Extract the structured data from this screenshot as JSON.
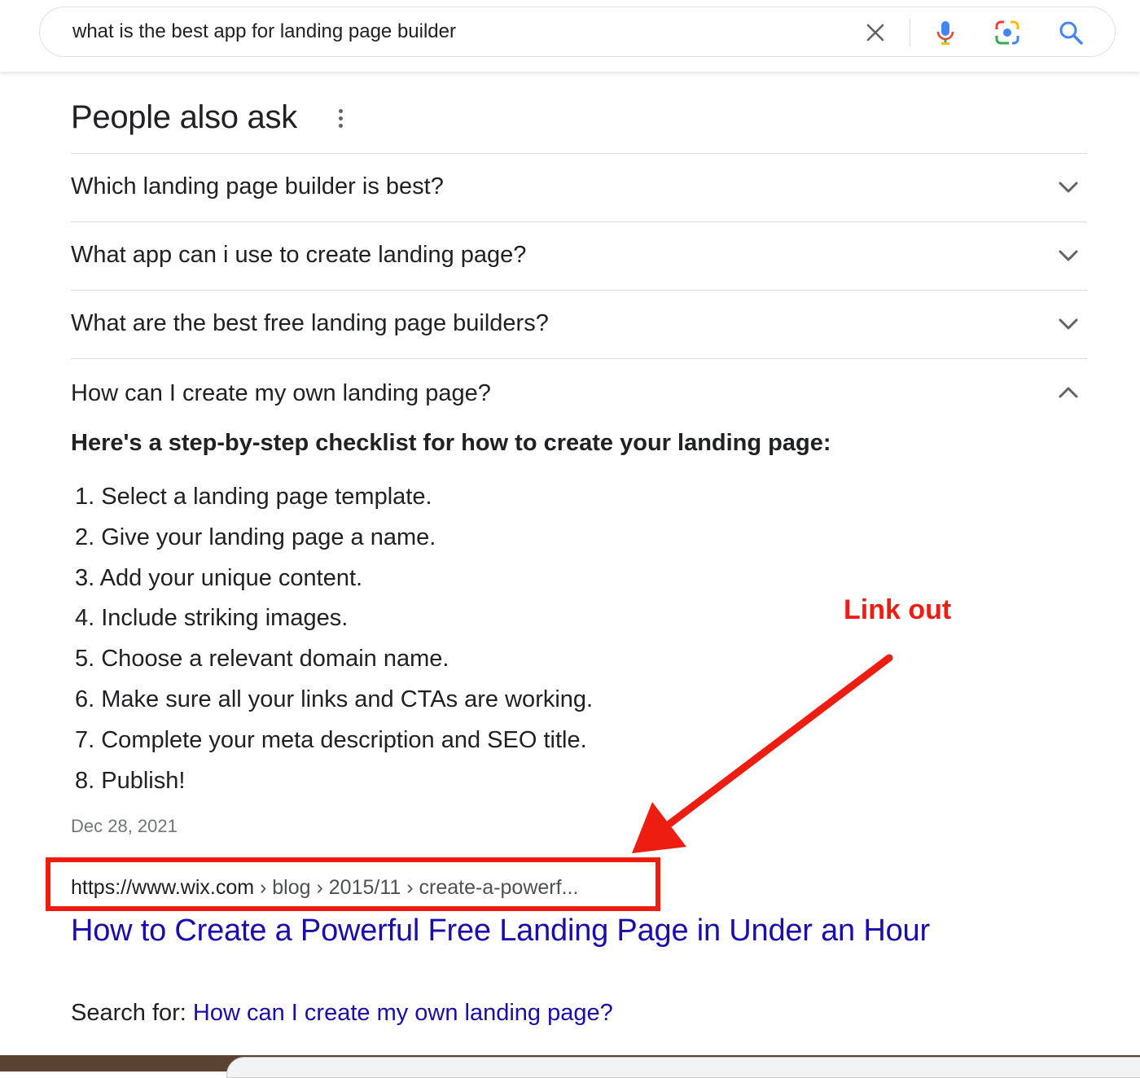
{
  "search": {
    "query": "what is the best app for landing page builder",
    "icons": [
      "close-icon",
      "mic-icon",
      "lens-icon",
      "search-icon"
    ]
  },
  "paa": {
    "title": "People also ask",
    "questions": [
      {
        "label": "Which landing page builder is best?",
        "expanded": false
      },
      {
        "label": "What app can i use to create landing page?",
        "expanded": false
      },
      {
        "label": "What are the best free landing page builders?",
        "expanded": false
      },
      {
        "label": "How can I create my own landing page?",
        "expanded": true
      }
    ],
    "answer": {
      "heading": "Here's a step-by-step checklist for how to create your landing page:",
      "steps": [
        "1. Select a landing page template.",
        "2. Give your landing page a name.",
        "3. Add your unique content.",
        "4. Include striking images.",
        "5. Choose a relevant domain name.",
        "6. Make sure all your links and CTAs are working.",
        "7. Complete your meta description and SEO title.",
        "8. Publish!"
      ],
      "date": "Dec 28, 2021",
      "source_domain": "https://www.wix.com",
      "source_crumbs": " › blog › 2015/11 › create-a-powerf...",
      "result_title": "How to Create a Powerful Free Landing Page in Under an Hour",
      "search_for_label": "Search for: ",
      "search_for_link": "How can I create my own landing page?"
    }
  },
  "annotation": {
    "label": "Link out",
    "color": "#ee1d12"
  },
  "colors": {
    "link": "#1a0dab",
    "text": "#202124",
    "muted": "#70757a"
  }
}
